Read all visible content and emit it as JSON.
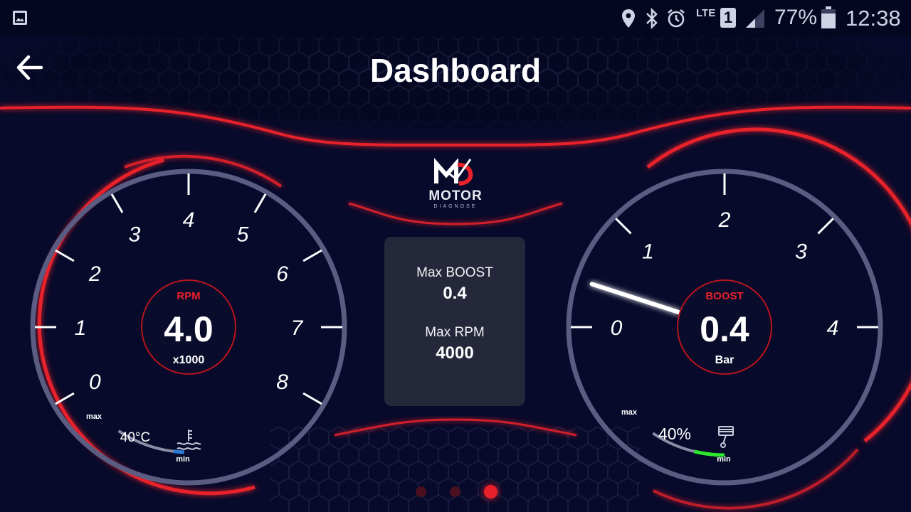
{
  "status_bar": {
    "battery": "77%",
    "time": "12:38",
    "network": "LTE",
    "sim": "1",
    "icons": [
      "gallery-icon",
      "location-icon",
      "bluetooth-icon",
      "alarm-icon",
      "signal-icon",
      "battery-icon"
    ]
  },
  "header": {
    "title": "Dashboard"
  },
  "logo": {
    "line1": "MOTOR",
    "line2": "DIAGNOSE"
  },
  "rpm_gauge": {
    "label": "RPM",
    "value": "4.0",
    "unit": "x1000",
    "value_numeric": 4.0,
    "ticks": [
      "0",
      "1",
      "2",
      "3",
      "4",
      "5",
      "6",
      "7",
      "8"
    ],
    "temp_label": "40°C",
    "min_label": "min",
    "max_label": "max",
    "temp_level": 0.15
  },
  "boost_gauge": {
    "label": "BOOST",
    "value": "0.4",
    "unit": "Bar",
    "value_numeric": 0.4,
    "ticks": [
      "0",
      "1",
      "2",
      "3",
      "4"
    ],
    "load_label": "40%",
    "min_label": "min",
    "max_label": "max",
    "load_level": 0.4
  },
  "center_panel": {
    "max_boost_label": "Max BOOST",
    "max_boost_value": "0.4",
    "max_rpm_label": "Max RPM",
    "max_rpm_value": "4000"
  },
  "pager": {
    "count": 3,
    "active": 2
  },
  "colors": {
    "accent": "#e8202a",
    "background": "#070a2a",
    "ring": "#5a5c82",
    "boost_bar": "#2ee82e",
    "temp_bar": "#2a7ad8"
  }
}
